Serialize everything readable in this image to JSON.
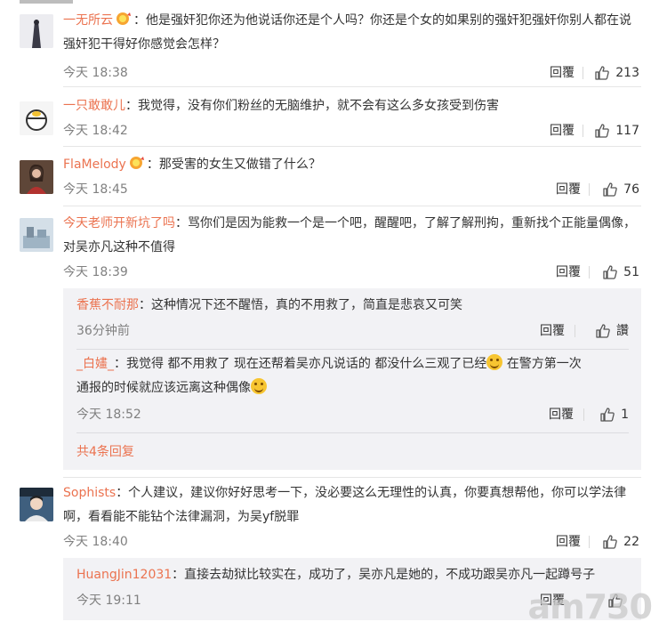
{
  "comments": [
    {
      "user": "一无所云",
      "has_badge": true,
      "text": "：他是强奸犯你还为他说话你还是个人吗？你还是个女的如果别的强奸犯强奸你别人都在说强奸犯干得好你感觉会怎样？",
      "time": "今天 18:38",
      "reply_label": "回覆",
      "likes": "213"
    },
    {
      "user": "一只敢敢儿",
      "has_badge": false,
      "text": "：我觉得，没有你们粉丝的无脑维护，就不会有这么多女孩受到伤害",
      "time": "今天 18:42",
      "reply_label": "回覆",
      "likes": "117"
    },
    {
      "user": "FlaMelody",
      "has_badge": true,
      "text": "：那受害的女生又做错了什么？",
      "time": "今天 18:45",
      "reply_label": "回覆",
      "likes": "76"
    },
    {
      "user": "今天老师开新坑了吗",
      "has_badge": false,
      "text": "：骂你们是因为能救一个是一个吧，醒醒吧，了解了解刑拘，重新找个正能量偶像，对吴亦凡这种不值得",
      "time": "今天 18:39",
      "reply_label": "回覆",
      "likes": "51",
      "sub_replies": [
        {
          "user": "香蕉不耐那",
          "text": "：这种情况下还不醒悟，真的不用救了，简直是悲哀又可笑",
          "time": "36分钟前",
          "reply_label": "回覆",
          "likes": "讚"
        },
        {
          "user": "_白嫿_",
          "text_a": "：我觉得 都不用救了  现在还帮着吴亦凡说话的 都没什么三观了已经",
          "text_b": " 在警方第一次",
          "text_c": "通报的时候就应该远离这种偶像",
          "time": "今天 18:52",
          "reply_label": "回覆",
          "likes": "1"
        }
      ],
      "more_label": "共4条回复"
    },
    {
      "user": "Sophists",
      "has_badge": false,
      "text": "：个人建议，建议你好好思考一下，没必要这么无理性的认真，你要真想帮他，你可以学法律啊，看看能不能钻个法律漏洞，为吴yf脱罪",
      "time": "今天 18:40",
      "reply_label": "回覆",
      "likes": "22",
      "sub_replies": [
        {
          "user": "HuangJin12031",
          "text": "：直接去劫狱比较实在，成功了，吴亦凡是她的，不成功跟吴亦凡一起蹲号子",
          "time": "今天 19:11",
          "reply_label": "回覆",
          "likes": ""
        }
      ]
    }
  ],
  "watermark": "am730",
  "icons": {
    "thumb": "thumbs-up-icon",
    "emoji": "laughing-tears-emoji-icon",
    "badge": "vip-badge-icon"
  },
  "colors": {
    "username": "#eb7350",
    "time": "#808080",
    "subbox_bg": "#f2f2f5"
  }
}
